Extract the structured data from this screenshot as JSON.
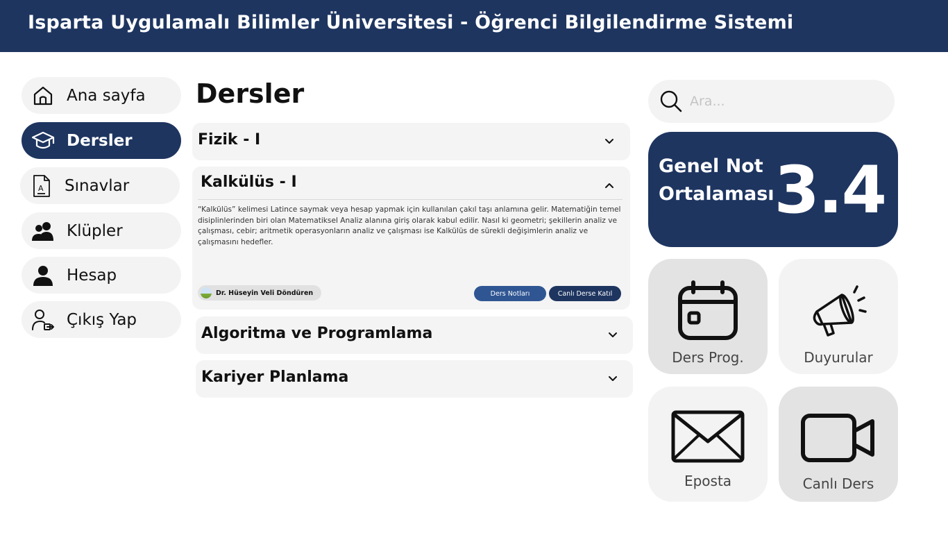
{
  "header": {
    "title": "Isparta Uygulamalı Bilimler Üniversitesi - Öğrenci Bilgilendirme Sistemi"
  },
  "sidebar": {
    "items": [
      {
        "label": "Ana sayfa",
        "icon": "home-icon",
        "active": false
      },
      {
        "label": "Dersler",
        "icon": "graduation-cap-icon",
        "active": true
      },
      {
        "label": "Sınavlar",
        "icon": "exam-document-icon",
        "active": false
      },
      {
        "label": "Klüpler",
        "icon": "group-icon",
        "active": false
      },
      {
        "label": "Hesap",
        "icon": "user-icon",
        "active": false
      },
      {
        "label": "Çıkış Yap",
        "icon": "logout-icon",
        "active": false
      }
    ]
  },
  "main": {
    "title": "Dersler",
    "courses": [
      {
        "name": "Fizik - I",
        "expanded": false
      },
      {
        "name": "Kalkülüs - I",
        "expanded": true,
        "description": "“Kalkülüs” kelimesi Latince saymak veya hesap yapmak için kullanılan çakıl taşı anlamına gelir. Matematiğin temel disiplinlerinden biri olan Matematiksel Analiz alanına giriş olarak kabul edilir. Nasıl ki geometri; şekillerin analiz ve çalışması, cebir; aritmetik operasyonların analiz ve çalışması ise Kalkülüs de sürekli değişimlerin analiz ve çalışmasını hedefler.",
        "teacher": "Dr. Hüseyin Veli Döndüren",
        "notes_button": "Ders Notları",
        "join_button": "Canlı Derse Katıl"
      },
      {
        "name": "Algoritma ve Programlama",
        "expanded": false
      },
      {
        "name": "Kariyer Planlama",
        "expanded": false
      }
    ]
  },
  "search": {
    "placeholder": "Ara..."
  },
  "gpa": {
    "label": "Genel Not Ortalaması",
    "value": "3.4"
  },
  "tiles": [
    {
      "label": "Ders Prog.",
      "icon": "calendar-icon"
    },
    {
      "label": "Duyurular",
      "icon": "megaphone-icon"
    },
    {
      "label": "Eposta",
      "icon": "envelope-icon"
    },
    {
      "label": "Canlı Ders",
      "icon": "video-camera-icon"
    }
  ],
  "colors": {
    "primary": "#1e3560",
    "button_notes": "#2f5693",
    "button_join": "#1e3560",
    "panel": "#f3f3f3"
  }
}
